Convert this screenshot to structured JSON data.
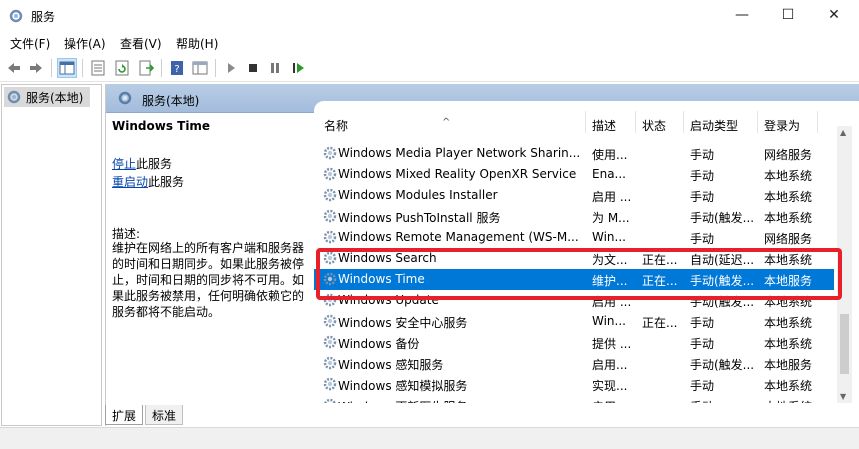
{
  "window": {
    "title": "服务",
    "minimize_glyph": "—",
    "maximize_glyph": "☐",
    "close_glyph": "✕"
  },
  "menu": [
    "文件(F)",
    "操作(A)",
    "查看(V)",
    "帮助(H)"
  ],
  "toolbar": {
    "icons": [
      "back-icon",
      "forward-icon",
      "show-hide-tree-icon",
      "properties-icon",
      "refresh-icon",
      "export-list-icon",
      "help-icon",
      "details-view-icon",
      "start-service-icon",
      "stop-service-icon",
      "pause-service-icon",
      "restart-service-icon"
    ]
  },
  "tree": {
    "root_label": "服务(本地)"
  },
  "main": {
    "header_label": "服务(本地)",
    "selected_service_title": "Windows Time",
    "action_stop_link": "停止",
    "action_stop_suffix": "此服务",
    "action_restart_link": "重启动",
    "action_restart_suffix": "此服务",
    "description_label": "描述:",
    "description_text": "维护在网络上的所有客户端和服务器的时间和日期同步。如果此服务被停止，时间和日期的同步将不可用。如果此服务被禁用，任何明确依赖它的服务都将不能启动。"
  },
  "columns": {
    "sort_glyph": "^",
    "name": "名称",
    "desc": "描述",
    "status": "状态",
    "startup": "启动类型",
    "logon": "登录为"
  },
  "rows": [
    {
      "name": "Windows Media Player Network Sharin...",
      "desc": "使用...",
      "status": "",
      "startup": "手动",
      "logon": "网络服务"
    },
    {
      "name": "Windows Mixed Reality OpenXR Service",
      "desc": "Ena...",
      "status": "",
      "startup": "手动",
      "logon": "本地系统"
    },
    {
      "name": "Windows Modules Installer",
      "desc": "启用 ...",
      "status": "",
      "startup": "手动",
      "logon": "本地系统"
    },
    {
      "name": "Windows PushToInstall 服务",
      "desc": "为 M...",
      "status": "",
      "startup": "手动(触发...",
      "logon": "本地系统"
    },
    {
      "name": "Windows Remote Management (WS-M...",
      "desc": "Win...",
      "status": "",
      "startup": "手动",
      "logon": "网络服务"
    },
    {
      "name": "Windows Search",
      "desc": "为文...",
      "status": "正在...",
      "startup": "自动(延迟...",
      "logon": "本地系统"
    },
    {
      "name": "Windows Time",
      "desc": "维护...",
      "status": "正在...",
      "startup": "手动(触发...",
      "logon": "本地服务"
    },
    {
      "name": "Windows Update",
      "desc": "启用 ...",
      "status": "",
      "startup": "手动(触发...",
      "logon": "本地系统"
    },
    {
      "name": "Windows 安全中心服务",
      "desc": "Win...",
      "status": "正在...",
      "startup": "手动",
      "logon": "本地系统"
    },
    {
      "name": "Windows 备份",
      "desc": "提供 ...",
      "status": "",
      "startup": "手动",
      "logon": "本地系统"
    },
    {
      "name": "Windows 感知服务",
      "desc": "启用...",
      "status": "",
      "startup": "手动(触发...",
      "logon": "本地服务"
    },
    {
      "name": "Windows 感知模拟服务",
      "desc": "实现...",
      "status": "",
      "startup": "手动",
      "logon": "本地系统"
    },
    {
      "name": "Windows 更新医生服务",
      "desc": "启用 ...",
      "status": "",
      "startup": "手动",
      "logon": "本地系统"
    }
  ],
  "selected_row_index": 6,
  "colors": {
    "selection": "#0078d7",
    "annotation_box": "#e8202a",
    "header_gradient": "#b9cde5"
  },
  "tabs": [
    "扩展",
    "标准"
  ]
}
